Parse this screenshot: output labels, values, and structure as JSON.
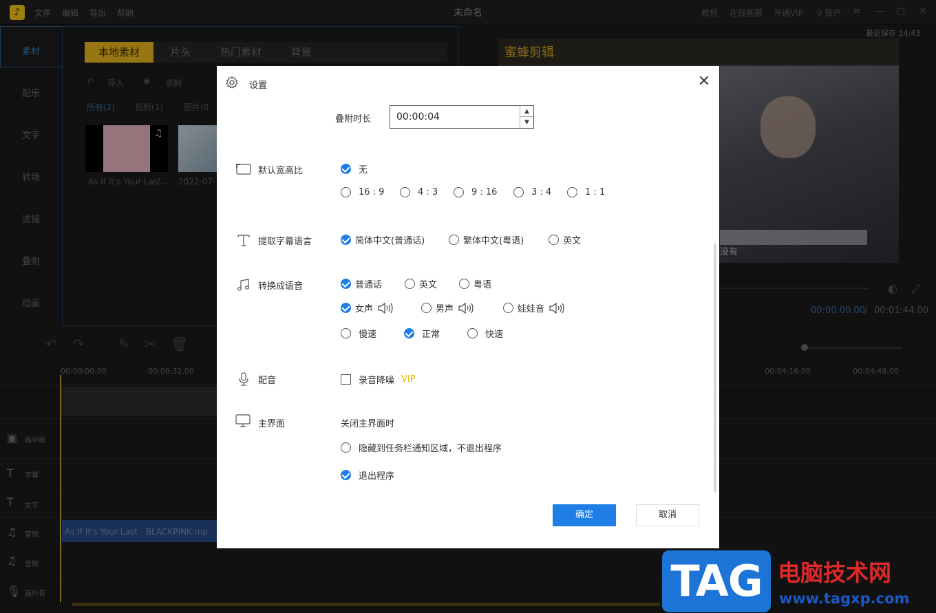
{
  "app": {
    "logo_glyph": "♪",
    "menu": [
      "文件",
      "编辑",
      "导出",
      "帮助"
    ],
    "title": "未命名",
    "right_links": [
      "教程",
      "在线客服",
      "开通VIP",
      "账户"
    ],
    "autosave": "最近保存 14:43"
  },
  "left_nav": [
    "素材",
    "配乐",
    "文字",
    "转场",
    "滤镜",
    "叠附",
    "动画"
  ],
  "media": {
    "tabs": [
      "本地素材",
      "片头",
      "热门素材",
      "背景"
    ],
    "toolbar": [
      "导入",
      "录制"
    ],
    "filters": [
      "所有(2)",
      "视频(1)",
      "图片(0"
    ],
    "items": [
      {
        "caption": "As If It's Your Last..."
      },
      {
        "caption": "2022-07-"
      }
    ]
  },
  "preview": {
    "brand": "蜜蜂剪辑",
    "subtitle_fragment": "没有",
    "time_current": "00:00:00.00",
    "time_sep": "/",
    "time_total": "00:01:44.00"
  },
  "timeline": {
    "ruler": [
      "00:00:00.00",
      "00:00:32.00",
      "00:04:16.00",
      "00:04:48.00"
    ],
    "tracks": [
      "画中画",
      "字幕",
      "文字",
      "音频",
      "音频",
      "画外音"
    ],
    "audio_clip": "As If It's Your Last - BLACKPINK.mp"
  },
  "dialog": {
    "title": "设置",
    "close_glyph": "✕",
    "overlay_duration": {
      "label": "叠附时长",
      "value": "00:00:04"
    },
    "aspect": {
      "label": "默认宽高比",
      "none_option": "无",
      "options": [
        "16 : 9",
        "4 : 3",
        "9 : 16",
        "3 : 4",
        "1 : 1"
      ]
    },
    "subtitle_lang": {
      "label": "提取字幕语言",
      "options": [
        "简体中文(普通话)",
        "繁体中文(粤语)",
        "英文"
      ]
    },
    "tts": {
      "label": "转换成语音",
      "languages": [
        "普通话",
        "英文",
        "粤语"
      ],
      "voices": [
        "女声",
        "男声",
        "娃娃音"
      ],
      "speeds": [
        "慢速",
        "正常",
        "快速"
      ]
    },
    "dubbing": {
      "label": "配音",
      "option": "录音降噪",
      "vip": "VIP"
    },
    "main_ui": {
      "label": "主界面",
      "caption": "关闭主界面时",
      "options": [
        "隐藏到任务栏通知区域，不退出程序",
        "退出程序"
      ]
    },
    "ok": "确定",
    "cancel": "取消",
    "accent": "#1e7ee6"
  },
  "watermark": {
    "tag": "TAG",
    "cn": "电脑技术网",
    "url": "www.tagxp.com"
  }
}
